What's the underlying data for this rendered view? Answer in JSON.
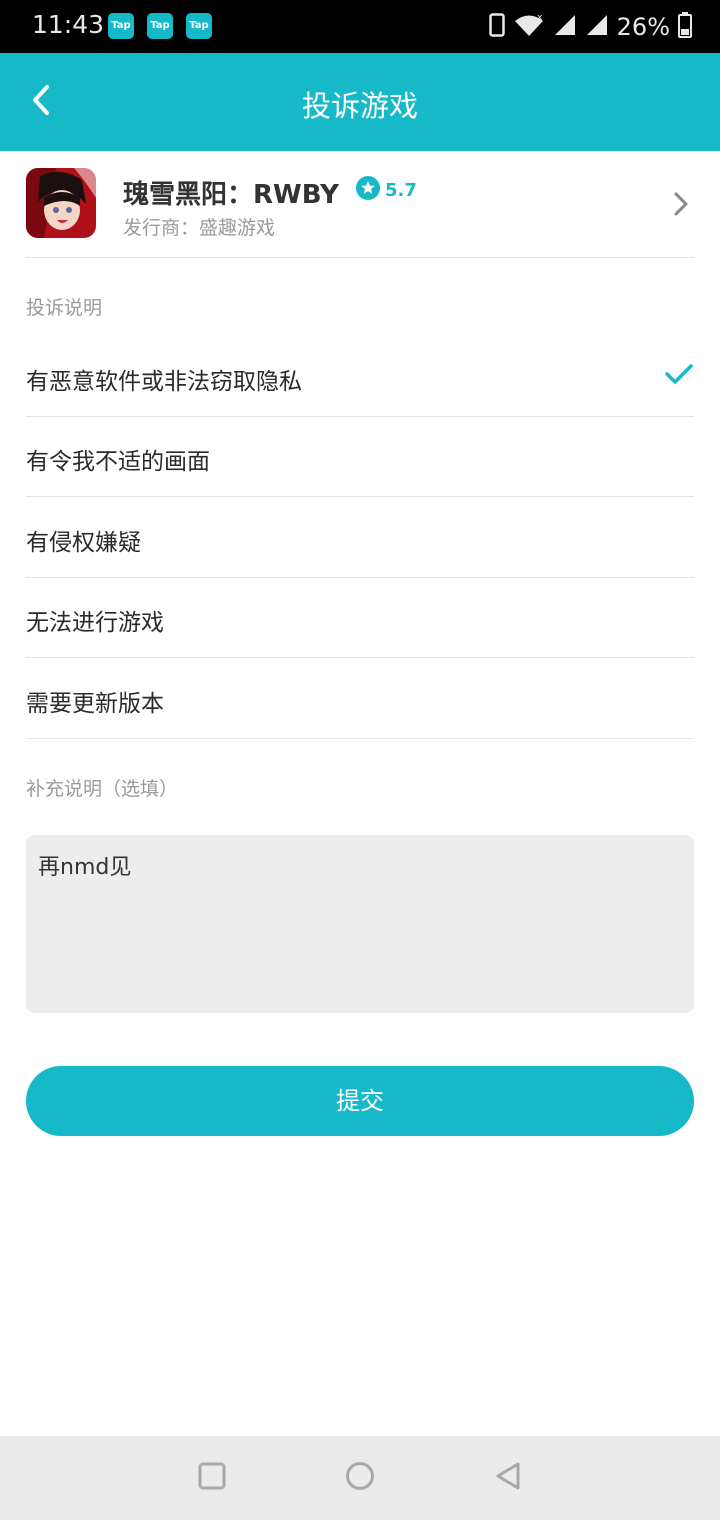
{
  "status_bar": {
    "time": "11:43",
    "notification_badges": [
      "Tap",
      "Tap",
      "Tap"
    ],
    "battery_percent": "26%",
    "icons": [
      "phone-icon",
      "wifi-icon",
      "signal-icon",
      "signal-icon",
      "battery-icon"
    ]
  },
  "header": {
    "title": "投诉游戏",
    "back_icon": "back-arrow-icon",
    "background_color": "#15b9c7"
  },
  "game": {
    "name": "瑰雪黑阳：RWBY",
    "rating": "5.7",
    "publisher": "发行商：盛趣游戏",
    "icon": "game-app-icon"
  },
  "complaint": {
    "section_label": "投诉说明",
    "options": [
      {
        "label": "有恶意软件或非法窃取隐私",
        "selected": true
      },
      {
        "label": "有令我不适的画面",
        "selected": false
      },
      {
        "label": "有侵权嫌疑",
        "selected": false
      },
      {
        "label": "无法进行游戏",
        "selected": false
      },
      {
        "label": "需要更新版本",
        "selected": false
      }
    ]
  },
  "supplement": {
    "section_label": "补充说明（选填）",
    "value": "再nmd见"
  },
  "submit": {
    "label": "提交"
  },
  "nav_bar": {
    "buttons": [
      "recents-icon",
      "home-icon",
      "back-icon"
    ]
  }
}
